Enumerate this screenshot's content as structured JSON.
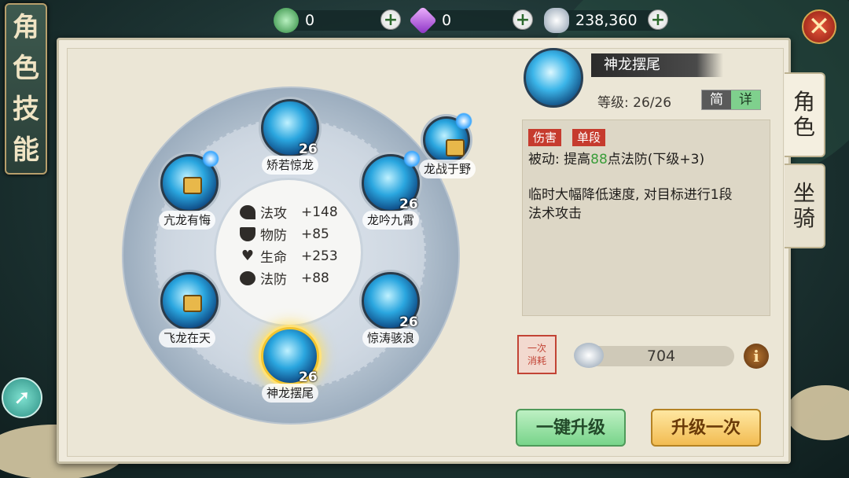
{
  "title": {
    "chars": [
      "角",
      "色",
      "技",
      "能"
    ]
  },
  "currency": {
    "jade": {
      "value": "0",
      "icon": "jade-coin-icon"
    },
    "gem": {
      "value": "0",
      "icon": "purple-gem-icon"
    },
    "silver": {
      "value": "238,360",
      "icon": "silver-ingot-icon"
    }
  },
  "side_tabs": [
    {
      "label": "角\n色",
      "active": true
    },
    {
      "label": "坐\n骑",
      "active": false
    }
  ],
  "stats": [
    {
      "label": "法攻",
      "value": "+148",
      "icon": "magic-attack-icon"
    },
    {
      "label": "物防",
      "value": "+85",
      "icon": "shield-icon"
    },
    {
      "label": "生命",
      "value": "+253",
      "icon": "heart-icon"
    },
    {
      "label": "法防",
      "value": "+88",
      "icon": "magic-defense-icon"
    }
  ],
  "skills": [
    {
      "name": "矫若惊龙",
      "level": "26",
      "locked": false,
      "selected": false
    },
    {
      "name": "龙战于野",
      "level": "",
      "locked": true,
      "selected": false
    },
    {
      "name": "亢龙有悔",
      "level": "",
      "locked": true,
      "selected": false
    },
    {
      "name": "龙吟九霄",
      "level": "26",
      "locked": false,
      "selected": false
    },
    {
      "name": "飞龙在天",
      "level": "",
      "locked": true,
      "selected": false
    },
    {
      "name": "惊涛骇浪",
      "level": "26",
      "locked": false,
      "selected": false
    },
    {
      "name": "神龙摆尾",
      "level": "26",
      "locked": false,
      "selected": true
    }
  ],
  "detail": {
    "name": "神龙摆尾",
    "level_label": "等级: 26/26",
    "toggle": {
      "simple": "简",
      "detail": "详"
    },
    "tags": [
      "伤害",
      "单段"
    ],
    "passive_prefix": "被动: 提高",
    "passive_value": "88",
    "passive_suffix": "点法防(下级+3)",
    "description_line1": "临时大幅降低速度, 对目标进行1段",
    "description_line2": "法术攻击",
    "cost_stamp": "一次\n消耗",
    "cost_value": "704",
    "info": "i"
  },
  "buttons": {
    "upgrade_all": "一键升级",
    "upgrade_once": "升级一次"
  },
  "colors": {
    "accent_green": "#78d48a",
    "accent_gold": "#f2bc52",
    "tag_red": "#c63b2e",
    "highlight_green": "#3a9d3a"
  }
}
